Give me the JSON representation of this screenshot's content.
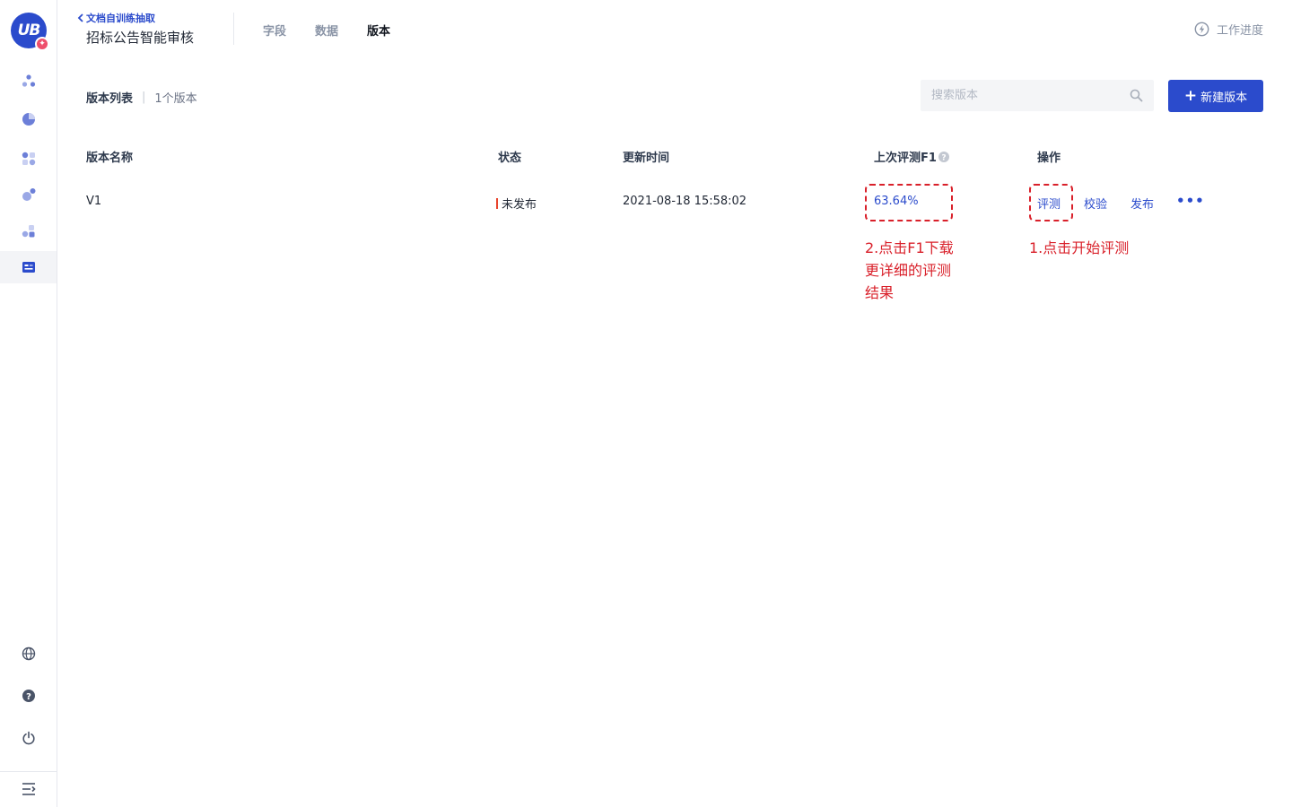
{
  "logo": {
    "text": "UB",
    "badge": "✦"
  },
  "sidebar": {
    "items": [
      {
        "icon": "nodes-icon"
      },
      {
        "icon": "pie-icon"
      },
      {
        "icon": "blocks-icon"
      },
      {
        "icon": "bubbles-icon"
      },
      {
        "icon": "cubes-icon"
      },
      {
        "icon": "document-extract-icon",
        "active": true
      }
    ],
    "bottom": [
      {
        "icon": "globe-icon"
      },
      {
        "icon": "help-icon"
      },
      {
        "icon": "power-icon"
      },
      {
        "icon": "menu-collapse-icon"
      }
    ]
  },
  "header": {
    "back_label": "文档自训练抽取",
    "project_title": "招标公告智能审核",
    "tabs": [
      {
        "label": "字段",
        "active": false
      },
      {
        "label": "数据",
        "active": false
      },
      {
        "label": "版本",
        "active": true
      }
    ],
    "progress_label": "工作进度"
  },
  "list": {
    "title": "版本列表",
    "count_label": "1个版本",
    "search_placeholder": "搜索版本",
    "new_button_label": "新建版本"
  },
  "table": {
    "columns": [
      "版本名称",
      "状态",
      "更新时间",
      "上次评测F1",
      "操作"
    ],
    "rows": [
      {
        "name": "V1",
        "status": "未发布",
        "updated": "2021-08-18 15:58:02",
        "f1": "63.64%",
        "actions": [
          "评测",
          "校验",
          "发布"
        ],
        "more": "•••"
      }
    ]
  },
  "annotations": {
    "f1_note": [
      "2.点击F1下载",
      "更详细的评测",
      "结果"
    ],
    "eval_note": "1.点击开始评测"
  },
  "colors": {
    "primary": "#2b4bcc",
    "annotation": "#d9202a",
    "status_unpublished": "#e8442d"
  }
}
